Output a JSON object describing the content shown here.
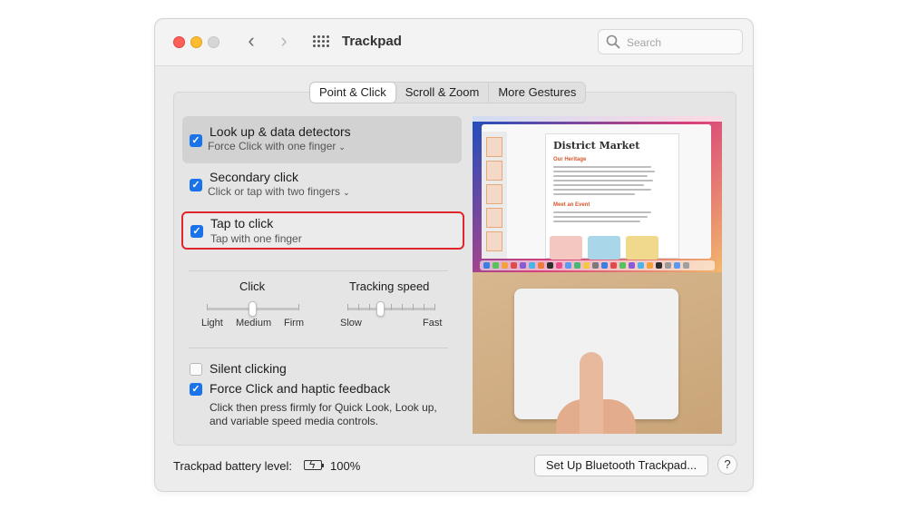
{
  "window": {
    "title": "Trackpad"
  },
  "search": {
    "placeholder": "Search"
  },
  "tabs": [
    {
      "label": "Point & Click",
      "active": true
    },
    {
      "label": "Scroll & Zoom",
      "active": false
    },
    {
      "label": "More Gestures",
      "active": false
    }
  ],
  "options": {
    "lookup": {
      "title": "Look up & data detectors",
      "subtitle": "Force Click with one finger",
      "checked": true
    },
    "secondary": {
      "title": "Secondary click",
      "subtitle": "Click or tap with two fingers",
      "checked": true
    },
    "tap": {
      "title": "Tap to click",
      "subtitle": "Tap with one finger",
      "checked": true
    }
  },
  "click_slider": {
    "title": "Click",
    "labels": [
      "Light",
      "Medium",
      "Firm"
    ],
    "value": "Medium"
  },
  "tracking_slider": {
    "title": "Tracking speed",
    "min_label": "Slow",
    "max_label": "Fast",
    "level": 0.375
  },
  "silent_clicking": {
    "label": "Silent clicking",
    "checked": false
  },
  "force_click": {
    "label": "Force Click and haptic feedback",
    "description_line1": "Click then press firmly for Quick Look, Look up,",
    "description_line2": "and variable speed media controls.",
    "checked": true
  },
  "preview": {
    "doc_title": "District Market",
    "section1": "Our Heritage",
    "section2": "Meet an Event"
  },
  "footer": {
    "battery_label": "Trackpad battery level:",
    "battery_value": "100%",
    "bluetooth_button": "Set Up Bluetooth Trackpad...",
    "help": "?"
  },
  "colors": {
    "accent": "#1a73e8",
    "highlight_border": "#e0262b",
    "close": "#fe5f57",
    "minimize": "#febc2e"
  }
}
